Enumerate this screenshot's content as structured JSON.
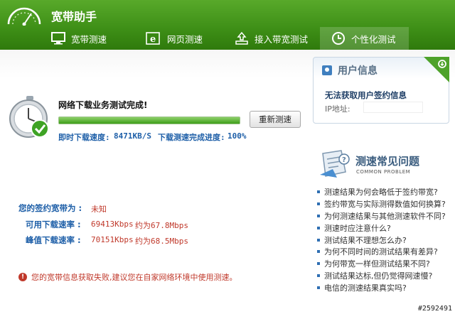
{
  "app": {
    "title": "宽带助手"
  },
  "tabs": [
    {
      "label": "宽带测速",
      "icon": "monitor-icon"
    },
    {
      "label": "网页测速",
      "icon": "browser-e-icon"
    },
    {
      "label": "接入带宽测试",
      "icon": "network-upload-icon"
    },
    {
      "label": "个性化测试",
      "icon": "clock-icon",
      "active": true
    }
  ],
  "test": {
    "status": "网络下载业务测试完成!",
    "progress_percent": 100,
    "retest_label": "重新测速",
    "instant_speed_label": "即时下载速度:",
    "instant_speed_value": "8471KB/S",
    "progress_label": "下载测速完成进度:",
    "progress_value": "100%"
  },
  "subscription": {
    "bandwidth_label": "您的签约宽带为 :",
    "bandwidth_value": "未知",
    "available_label": "可用下载速率 :",
    "available_kbps": "69413Kbps",
    "available_mbps": "约为67.8Mbps",
    "peak_label": "峰值下载速率 :",
    "peak_kbps": "70151Kbps",
    "peak_mbps": "约为68.5Mbps"
  },
  "error": {
    "message": "您的宽带信息获取失败,建议您在自家网络环境中使用测速。"
  },
  "user_info": {
    "title": "用户信息",
    "message": "无法获取用户签约信息",
    "ip_label": "IP地址:"
  },
  "faq": {
    "title": "测速常见问题",
    "subtitle": "COMMON PROBLEM",
    "items": [
      "测速结果为何会略低于签约带宽?",
      "签约带宽与实际测得数值如何换算?",
      "为何测速结果与其他测速软件不同?",
      "测速时应注意什么?",
      "测试结果不理想怎么办?",
      "为何不同时间的测试结果有差异?",
      "为何带宽一样但测试结果不同?",
      "测试结果达标,但仍觉得网速慢?",
      "电信的测速结果真实吗?"
    ]
  },
  "watermark": "#2592491",
  "colors": {
    "header_green": "#3d8e16",
    "link_blue": "#1e5fa8",
    "alert_red": "#c0392b"
  }
}
